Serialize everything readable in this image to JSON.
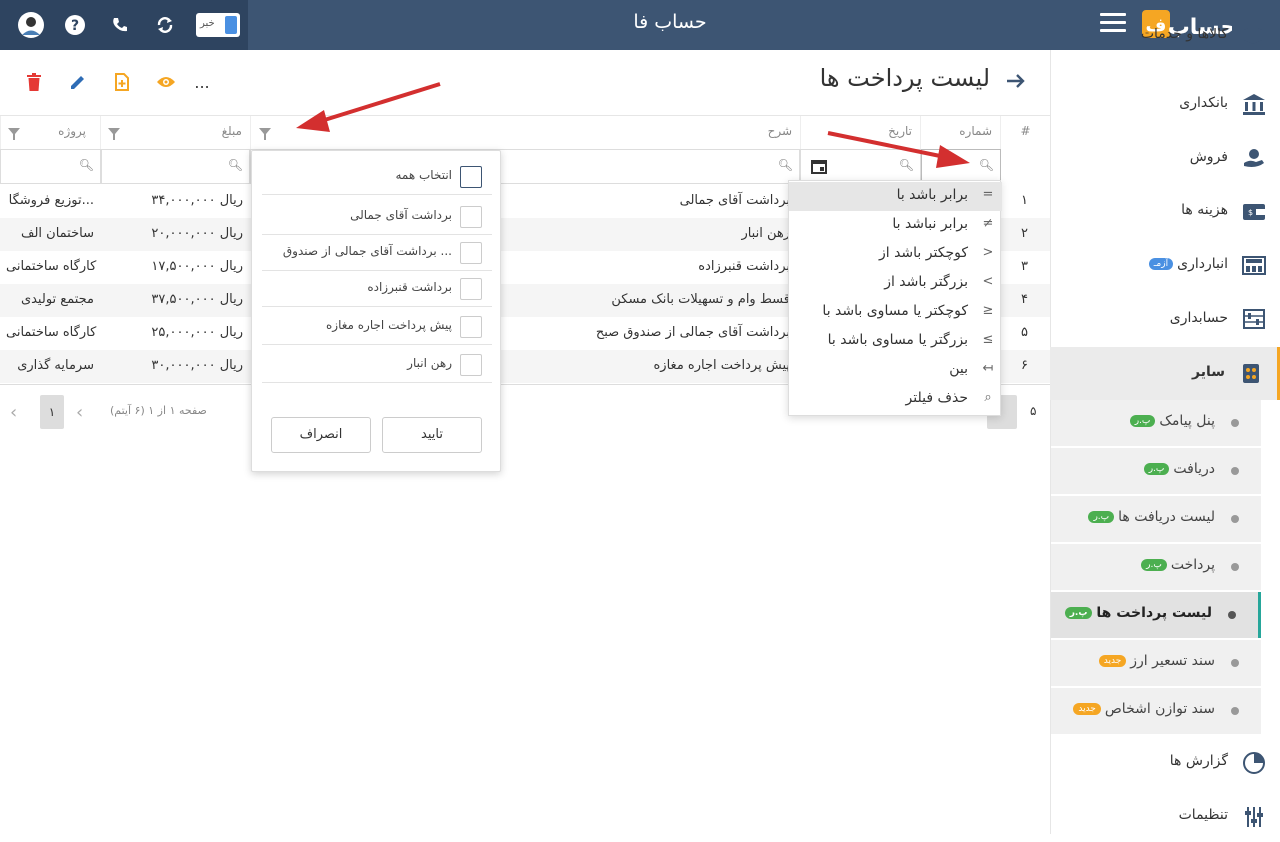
{
  "topbar": {
    "app_title": "حساب فا",
    "news_label": "خبر",
    "brand_logo_text": "حساب فا"
  },
  "sidebar": {
    "items": [
      {
        "label": "کالاها و خدمات",
        "icon": "box-icon"
      },
      {
        "label": "بانکداری",
        "icon": "bank-icon"
      },
      {
        "label": "فروش",
        "icon": "sales-icon"
      },
      {
        "label": "هزینه ها",
        "icon": "wallet-icon"
      },
      {
        "label": "انبارداری",
        "icon": "warehouse-icon",
        "badge": "آزمـ"
      },
      {
        "label": "حسابداری",
        "icon": "abacus-icon"
      },
      {
        "label": "سایر",
        "icon": "other-icon"
      }
    ],
    "sub_items": [
      {
        "label": "پنل پیامک",
        "badge": "پ.ر"
      },
      {
        "label": "دریافت",
        "badge": "پ.ر"
      },
      {
        "label": "لیست دریافت ها",
        "badge": "پ.ر"
      },
      {
        "label": "پرداخت",
        "badge": "پ.ر"
      },
      {
        "label": "لیست پرداخت ها",
        "badge": "پ.ر"
      },
      {
        "label": "سند تسعیر ارز",
        "badge": "جدید"
      },
      {
        "label": "سند توازن اشخاص",
        "badge": "جدید"
      }
    ],
    "bottom_items": [
      {
        "label": "گزارش ها",
        "icon": "report-icon"
      },
      {
        "label": "تنظیمات",
        "icon": "settings-icon"
      }
    ],
    "colors": {
      "green_badge": "#4caf50",
      "orange_badge": "#f5a623",
      "active_border": "#26a69a"
    }
  },
  "page": {
    "title": "لیست پرداخت ها",
    "more_label": "..."
  },
  "grid": {
    "headers": {
      "num": "#",
      "number": "شماره",
      "date": "تاریخ",
      "desc": "شرح",
      "amount": "مبلغ",
      "project": "پروژه"
    },
    "rows": [
      {
        "idx": "۱",
        "desc": "برداشت آقای جمالی",
        "amount": "۳۴,۰۰۰,۰۰۰ ریال",
        "project": "توزیع فروشگا..."
      },
      {
        "idx": "۲",
        "desc": "رهن انبار",
        "amount": "۲۰,۰۰۰,۰۰۰ ریال",
        "project": "ساختمان الف"
      },
      {
        "idx": "۳",
        "desc": "برداشت قنبرزاده",
        "amount": "۱۷,۵۰۰,۰۰۰ ریال",
        "project": "کارگاه ساختمانی"
      },
      {
        "idx": "۴",
        "desc": "قسط وام و تسهیلات بانک مسکن",
        "amount": "۳۷,۵۰۰,۰۰۰ ریال",
        "project": "مجتمع تولیدی"
      },
      {
        "idx": "۵",
        "desc": "برداشت آقای جمالی از صندوق صبح",
        "amount": "۲۵,۰۰۰,۰۰۰ ریال",
        "project": "کارگاه ساختمانی"
      },
      {
        "idx": "۶",
        "desc": "پیش پرداخت اجاره مغازه",
        "amount": "۳۰,۰۰۰,۰۰۰ ریال",
        "project": "سرمایه گذاری"
      }
    ]
  },
  "filter_popup": {
    "select_all": "انتخاب همه",
    "options": [
      "برداشت آقای جمالی",
      "برداشت آقای جمالی از صندوق ...",
      "برداشت قنبرزاده",
      "پیش پرداخت اجاره مغازه",
      "رهن انبار"
    ],
    "confirm": "تایید",
    "cancel": "انصراف"
  },
  "operator_menu": {
    "options": [
      {
        "label": "برابر باشد با",
        "symbol": "="
      },
      {
        "label": "برابر نباشد با",
        "symbol": "≠"
      },
      {
        "label": "کوچکتر باشد از",
        "symbol": ">"
      },
      {
        "label": "بزرگتر باشد از",
        "symbol": "<"
      },
      {
        "label": "کوچکتر یا مساوی باشد با",
        "symbol": "≥"
      },
      {
        "label": "بزرگتر یا مساوی باشد با",
        "symbol": "≤"
      },
      {
        "label": "بین",
        "symbol": "↤"
      },
      {
        "label": "حذف فیلتر",
        "symbol": "⌕"
      }
    ]
  },
  "pager": {
    "info": "صفحه ۱ از ۱ (۶ آیتم)",
    "current_page": "۱",
    "page_size": "۵"
  }
}
